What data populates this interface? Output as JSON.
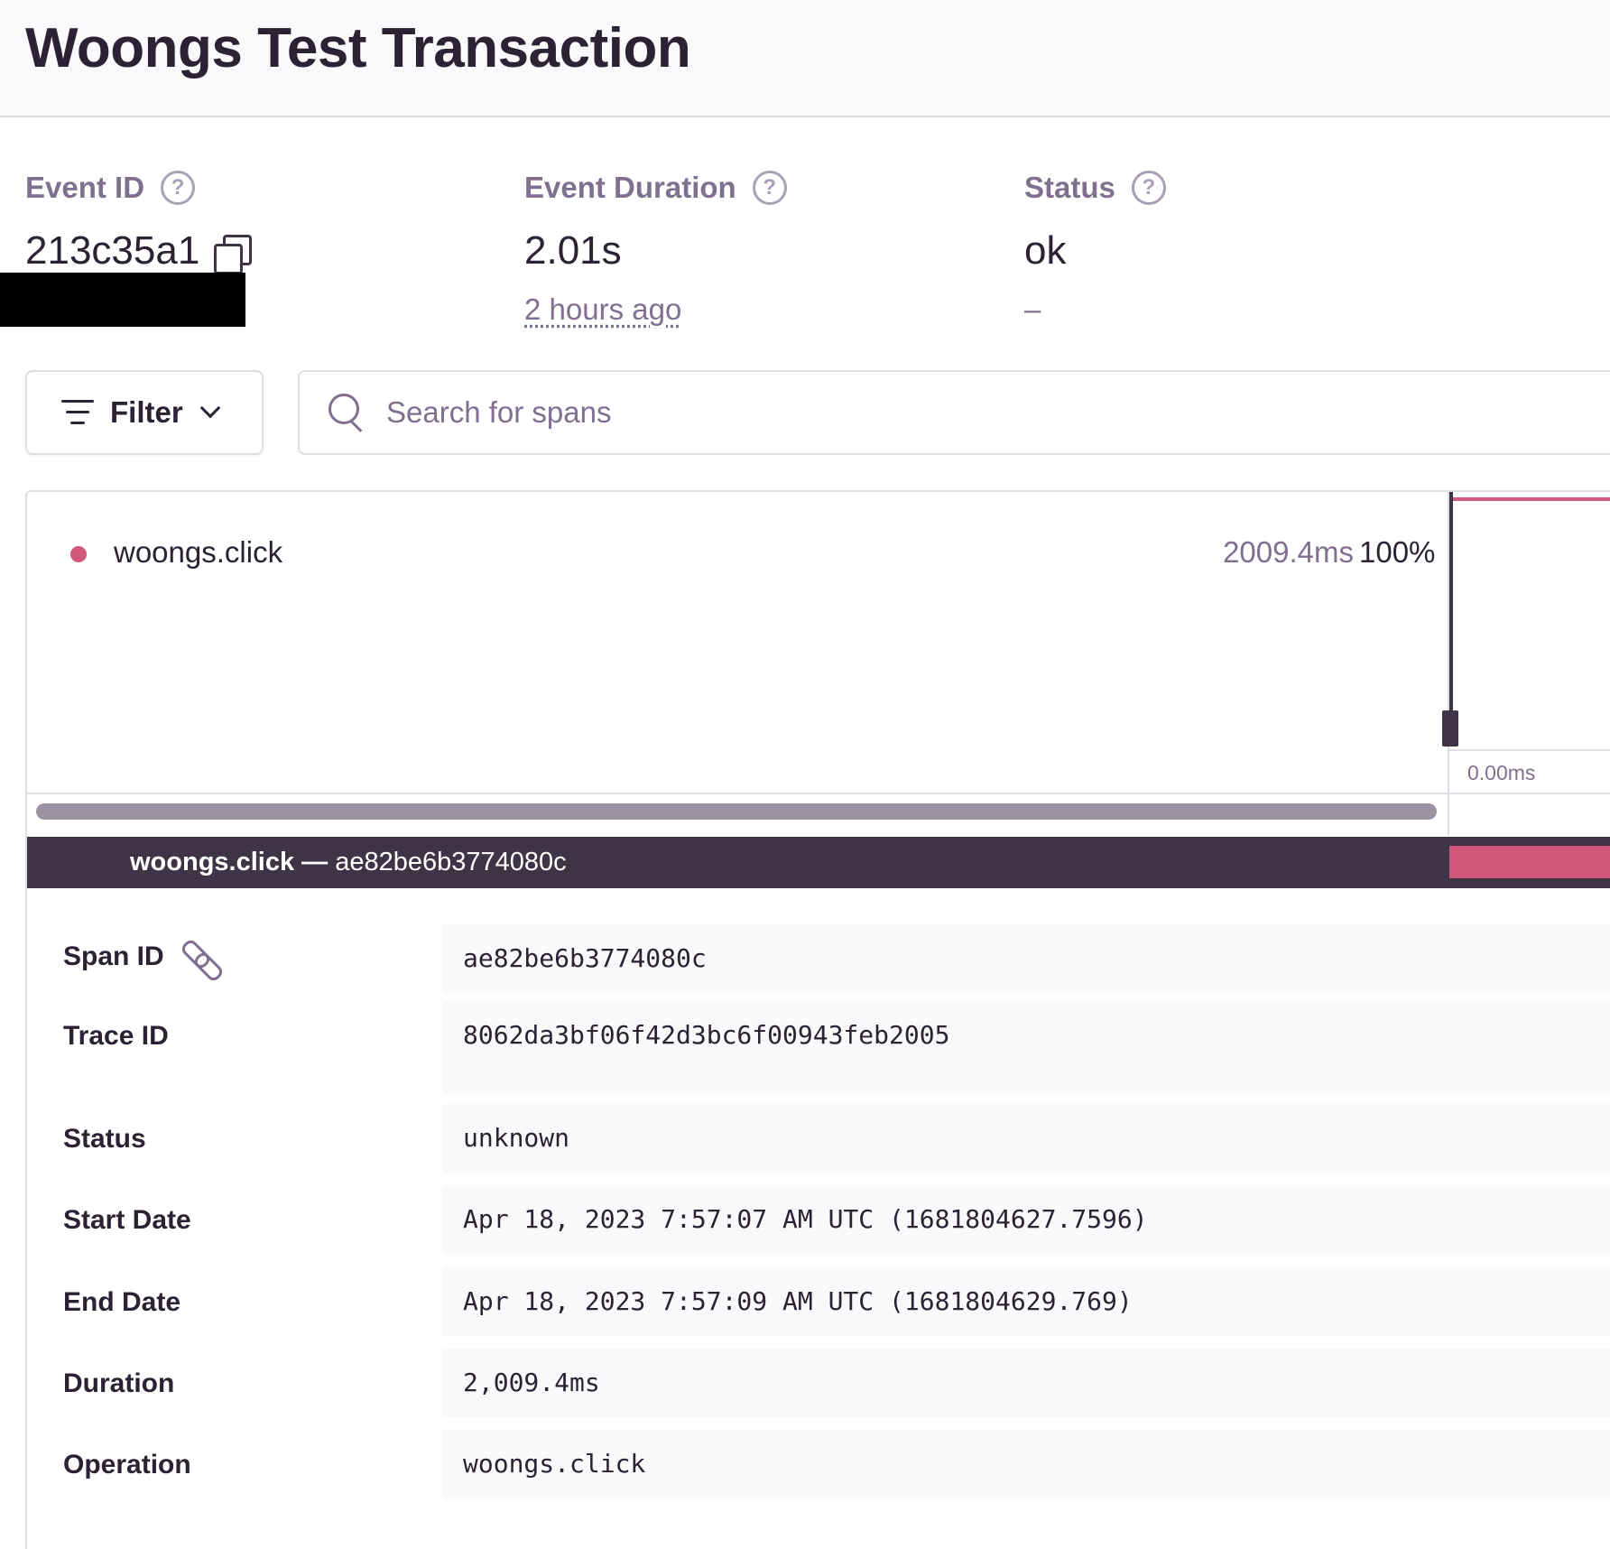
{
  "header": {
    "title": "Woongs Test Transaction"
  },
  "meta": {
    "event_id": {
      "label": "Event ID",
      "value": "213c35a1"
    },
    "event_duration": {
      "label": "Event Duration",
      "value": "2.01s",
      "sub": "2 hours ago"
    },
    "status": {
      "label": "Status",
      "value": "ok",
      "sub": "–"
    },
    "help_glyph": "?"
  },
  "toolbar": {
    "filter_label": "Filter",
    "search_placeholder": "Search for spans"
  },
  "trace": {
    "span": {
      "name": "woongs.click",
      "duration": "2009.4ms",
      "percent": "100%"
    },
    "timeline_tick": "0.00ms",
    "detail_header": {
      "op": "woongs.click",
      "separator": " — ",
      "span_id": "ae82be6b3774080c"
    }
  },
  "details": [
    {
      "key": "Span ID",
      "value": "ae82be6b3774080c"
    },
    {
      "key": "Trace ID",
      "value": "8062da3bf06f42d3bc6f00943feb2005"
    },
    {
      "key": "Status",
      "value": "unknown"
    },
    {
      "key": "Start Date",
      "value": "Apr 18, 2023 7:57:07 AM UTC (1681804627.7596)"
    },
    {
      "key": "End Date",
      "value": "Apr 18, 2023 7:57:09 AM UTC (1681804629.769)"
    },
    {
      "key": "Duration",
      "value": "2,009.4ms"
    },
    {
      "key": "Operation",
      "value": "woongs.click"
    }
  ],
  "colors": {
    "accent": "#d1587a",
    "dark": "#3e3446",
    "muted": "#80708f"
  },
  "icons": [
    "help-icon",
    "copy-icon",
    "filter-icon",
    "chevron-down-icon",
    "search-icon",
    "link-icon"
  ]
}
